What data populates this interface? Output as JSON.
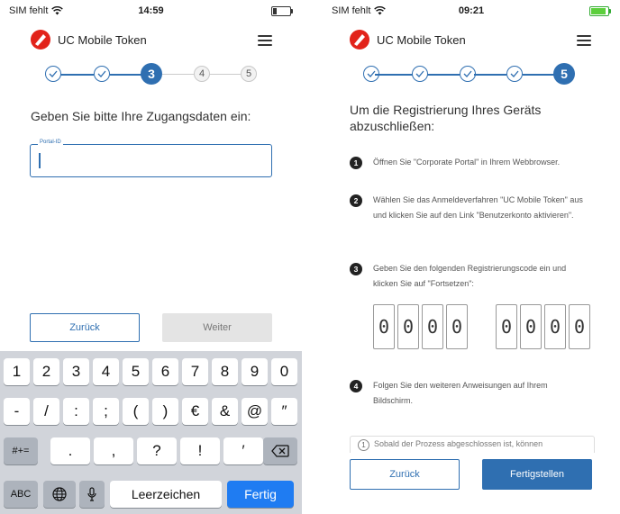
{
  "left": {
    "status": {
      "carrier": "SIM fehlt",
      "time": "14:59"
    },
    "app_title": "UC Mobile Token",
    "steps": [
      "3",
      "4",
      "5"
    ],
    "heading": "Geben Sie bitte Ihre Zugangsdaten ein:",
    "field": {
      "label": "Portal-ID",
      "value": ""
    },
    "back_label": "Zurück",
    "next_label": "Weiter",
    "keyboard": {
      "row1": [
        "1",
        "2",
        "3",
        "4",
        "5",
        "6",
        "7",
        "8",
        "9",
        "0"
      ],
      "row2": [
        "-",
        "/",
        ":",
        ";",
        "(",
        ")",
        "€",
        "&",
        "@",
        "″"
      ],
      "row3_left": "#+=",
      "row3": [
        ".",
        ",",
        "?",
        "!",
        "′"
      ],
      "abc": "ABC",
      "space": "Leerzeichen",
      "done": "Fertig"
    }
  },
  "right": {
    "status": {
      "carrier": "SIM fehlt",
      "time": "09:21"
    },
    "app_title": "UC Mobile Token",
    "steps": [
      "5"
    ],
    "heading": "Um die Registrierung Ihres Geräts abzuschließen:",
    "instructions": [
      {
        "num": "1",
        "text": "Öffnen Sie \"Corporate Portal\" in Ihrem Webbrowser."
      },
      {
        "num": "2",
        "text": "Wählen Sie das Anmeldeverfahren \"UC Mobile Token\" aus und klicken Sie auf den Link \"Benutzerkonto aktivieren\"."
      },
      {
        "num": "3",
        "text": "Geben Sie den folgenden Registrierungscode ein und klicken Sie auf \"Fortsetzen\":"
      },
      {
        "num": "4",
        "text": "Folgen Sie den weiteren Anweisungen auf Ihrem Bildschirm."
      }
    ],
    "code": [
      "0",
      "0",
      "0",
      "0",
      "0",
      "0",
      "0",
      "0"
    ],
    "info": {
      "icon": "1",
      "text": "Sobald der Prozess abgeschlossen ist, können"
    },
    "back_label": "Zurück",
    "finish_label": "Fertigstellen"
  },
  "colors": {
    "brand": "#2f6fb1",
    "logo_red": "#e2231a",
    "keyboard_bg": "#d1d4da",
    "done_key": "#1f7cf2"
  },
  "icons": [
    "wifi-icon",
    "battery-icon",
    "unicredit-logo-icon",
    "hamburger-menu-icon",
    "check-icon",
    "globe-icon",
    "microphone-icon",
    "backspace-icon",
    "info-icon"
  ]
}
